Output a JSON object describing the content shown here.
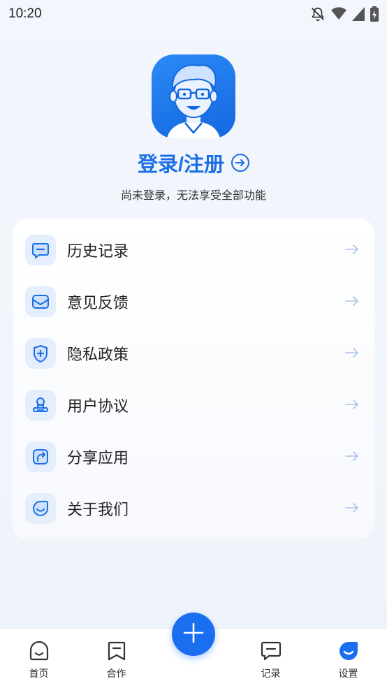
{
  "status_bar": {
    "time": "10:20",
    "icons": [
      "notifications-off-icon",
      "wifi-icon",
      "signal-icon",
      "battery-charging-icon"
    ]
  },
  "profile": {
    "avatar_icon": "user-avatar-icon",
    "login_label": "登录/注册",
    "login_arrow_icon": "arrow-right-circle-icon",
    "subtitle": "尚未登录，无法享受全部功能"
  },
  "menu": {
    "items": [
      {
        "label": "历史记录",
        "icon": "history-chat-icon"
      },
      {
        "label": "意见反馈",
        "icon": "feedback-mail-icon"
      },
      {
        "label": "隐私政策",
        "icon": "privacy-shield-icon"
      },
      {
        "label": "用户协议",
        "icon": "agreement-stamp-icon"
      },
      {
        "label": "分享应用",
        "icon": "share-icon"
      },
      {
        "label": "关于我们",
        "icon": "about-smile-icon"
      }
    ],
    "chevron_icon": "arrow-right-icon"
  },
  "bottom_nav": {
    "items": [
      {
        "label": "首页",
        "icon": "home-icon"
      },
      {
        "label": "合作",
        "icon": "bookmark-icon"
      },
      {
        "label": "记录",
        "icon": "record-chat-icon"
      },
      {
        "label": "设置",
        "icon": "settings-smile-icon",
        "active": true
      }
    ],
    "fab_icon": "plus-icon"
  },
  "colors": {
    "accent": "#1b6fe6",
    "active_tab": "#1a6ff0",
    "icon_bg": "#e5eefc"
  }
}
